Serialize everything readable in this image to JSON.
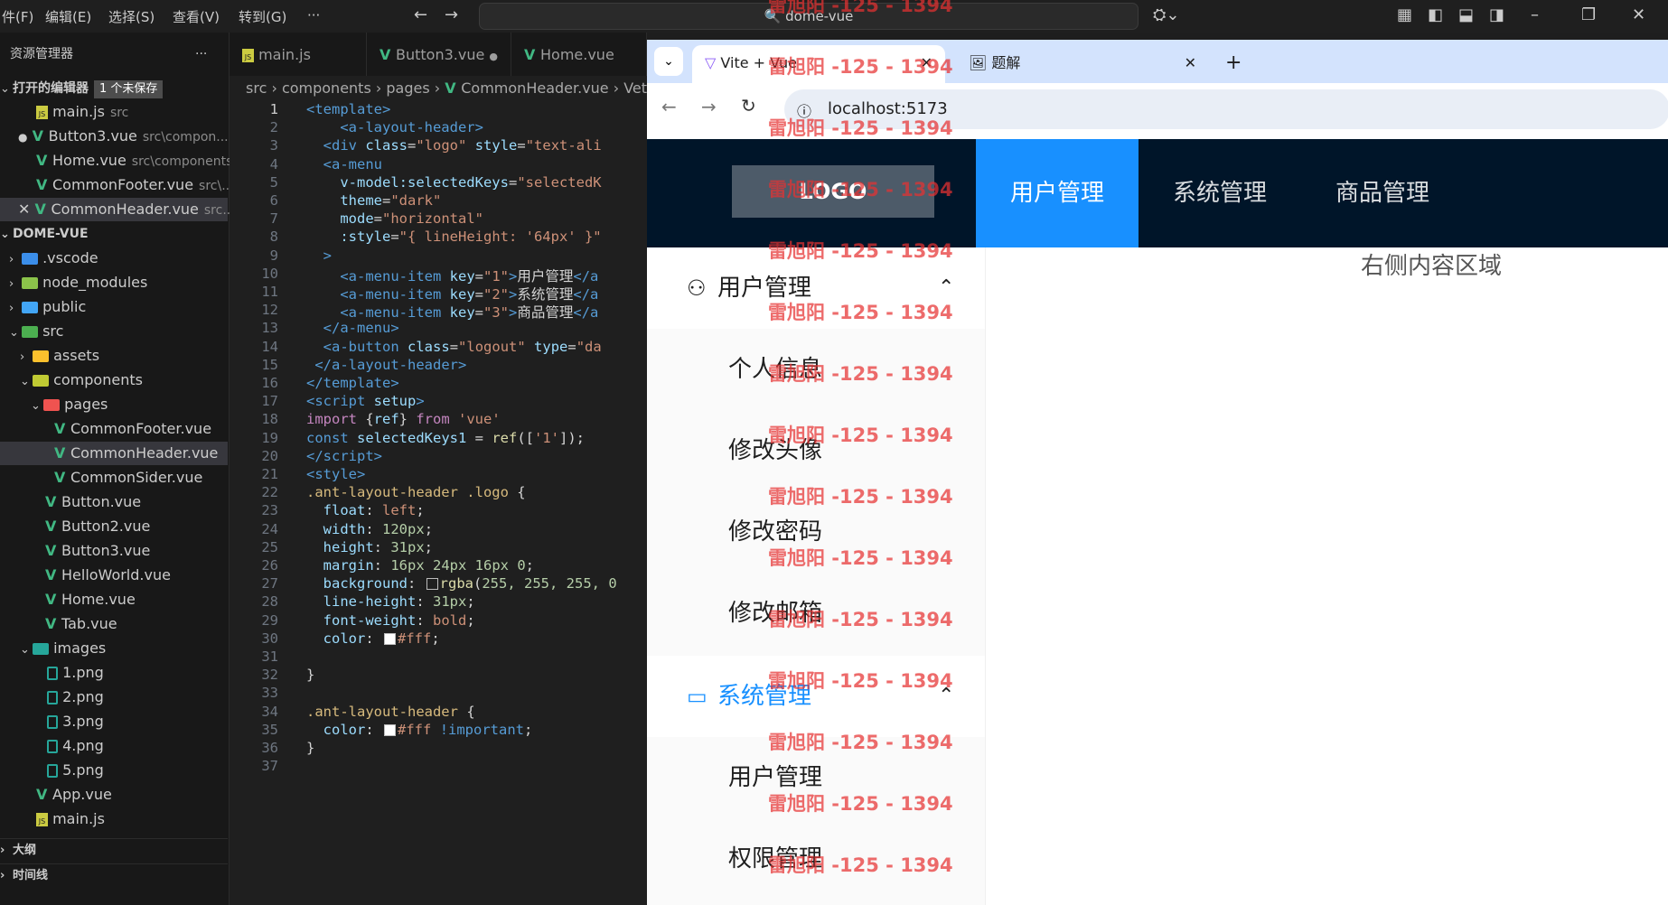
{
  "titlebar": {
    "menu": [
      "件(F)",
      "编辑(E)",
      "选择(S)",
      "查看(V)",
      "转到(G)",
      "···"
    ],
    "command_center": "dome-vue"
  },
  "sidebar": {
    "title": "资源管理器",
    "open_editors_label": "打开的编辑器",
    "unsaved_badge": "1 个未保存",
    "open_editors": [
      {
        "name": "main.js",
        "desc": "src"
      },
      {
        "name": "Button3.vue",
        "desc": "src\\compon..."
      },
      {
        "name": "Home.vue",
        "desc": "src\\components"
      },
      {
        "name": "CommonFooter.vue",
        "desc": "src\\..."
      },
      {
        "name": "CommonHeader.vue",
        "desc": "src..."
      }
    ],
    "project": "DOME-VUE",
    "tree": [
      ".vscode",
      "node_modules",
      "public",
      "src",
      "assets",
      "components",
      "pages",
      "CommonFooter.vue",
      "CommonHeader.vue",
      "CommonSider.vue",
      "Button.vue",
      "Button2.vue",
      "Button3.vue",
      "HelloWorld.vue",
      "Home.vue",
      "Tab.vue",
      "images",
      "1.png",
      "2.png",
      "3.png",
      "4.png",
      "5.png",
      "App.vue",
      "main.js"
    ],
    "outline": "大纲",
    "timeline": "时间线"
  },
  "editor": {
    "tabs": [
      "main.js",
      "Button3.vue",
      "Home.vue"
    ],
    "breadcrumb": [
      "src",
      "components",
      "pages",
      "CommonHeader.vue",
      "Vetur"
    ],
    "line_numbers": [
      "1",
      "2",
      "3",
      "4",
      "5",
      "6",
      "7",
      "8",
      "9",
      "10",
      "11",
      "12",
      "13",
      "14",
      "15",
      "16",
      "17",
      "18",
      "19",
      "20",
      "21",
      "22",
      "23",
      "24",
      "25",
      "26",
      "27",
      "28",
      "29",
      "30",
      "31",
      "32",
      "33",
      "34",
      "35",
      "36",
      "37"
    ]
  },
  "browser": {
    "tabs": [
      {
        "title": "Vite + Vue"
      },
      {
        "title": "题解"
      }
    ],
    "url": "localhost:5173",
    "app": {
      "logo": "LOGO",
      "top_menu": [
        "用户管理",
        "系统管理",
        "商品管理"
      ],
      "content_text": "右侧内容区域",
      "side_menu": [
        {
          "title": "用户管理",
          "items": [
            "个人信息",
            "修改头像",
            "修改密码",
            "修改邮箱"
          ]
        },
        {
          "title": "系统管理",
          "items": [
            "用户管理",
            "权限管理"
          ]
        }
      ]
    },
    "watermark": "雷旭阳 -125 - 1394"
  },
  "colors": {
    "accent": "#1890ff",
    "header_bg": "#001529",
    "vue_green": "#41b883",
    "watermark": "#e63232"
  }
}
